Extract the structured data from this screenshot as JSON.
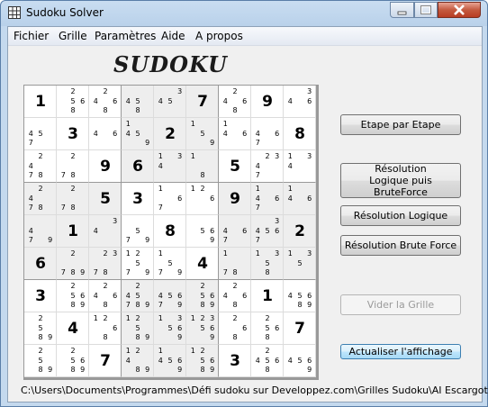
{
  "window": {
    "title": "Sudoku Solver"
  },
  "menu": [
    "Fichier",
    "Grille",
    "Paramètres",
    "Aide",
    "A propos"
  ],
  "brand": "SUDOKU",
  "buttons": {
    "step": "Etape par Etape",
    "logic_brute_line1": "Résolution",
    "logic_brute_line2": "Logique puis BruteForce",
    "logic": "Résolution Logique",
    "brute": "Résolution Brute Force",
    "clear": "Vider la Grille",
    "refresh": "Actualiser l'affichage"
  },
  "file_path": "C:\\Users\\Documents\\Programmes\\Défi sudoku sur Developpez.com\\Grilles Sudoku\\AI Escargot.txt",
  "grid": [
    [
      "1",
      "2568",
      "2468",
      "458",
      "345",
      "7",
      "2468",
      "9",
      "346"
    ],
    [
      "457",
      "3",
      "46",
      "1459",
      "2",
      "159",
      "146",
      "467",
      "8"
    ],
    [
      "2478",
      "278",
      "9",
      "6",
      "134",
      "18",
      "5",
      "2347",
      "134"
    ],
    [
      "2478",
      "278",
      "5",
      "3",
      "167",
      "126",
      "9",
      "1467",
      "146"
    ],
    [
      "479",
      "1",
      "34",
      "579",
      "8",
      "569",
      "467",
      "34567",
      "2"
    ],
    [
      "6",
      "2789",
      "2378",
      "12579",
      "1579",
      "4",
      "178",
      "1358",
      "135"
    ],
    [
      "3",
      "25689",
      "2468",
      "245789",
      "456790",
      "25689",
      "2468",
      "1",
      "45689"
    ],
    [
      "2589",
      "4",
      "1268",
      "12589",
      "13569",
      "123569",
      "268",
      "2568",
      "7"
    ],
    [
      "2589",
      "25689",
      "7",
      "12489",
      "14569",
      "125689",
      "3",
      "24568",
      "4569"
    ]
  ]
}
